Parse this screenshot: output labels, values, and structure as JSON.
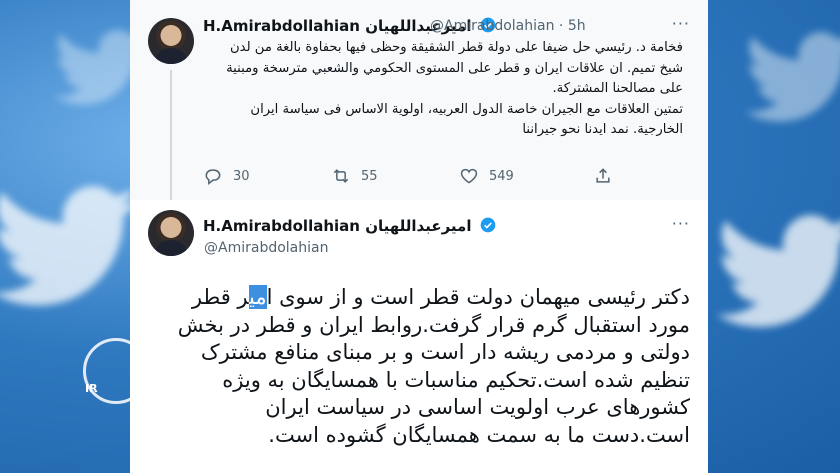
{
  "tweet1": {
    "name": "H.Amirabdollahian امیرعبداللهیان",
    "handle": "@Amirabdolahian · 5h",
    "more": "···",
    "text_p1": "فخامة د. رئيسي حل ضيفا على دولة قطر الشقيقة وحظى فيها بحفاوة بالغة من لدن شيخ تميم. ان علاقات ايران و قطر على المستوى الحكومي والشعبي مترسخة ومبنية على مصالحنا المشتركة.",
    "text_p2": "تمتين العلاقات مع الجيران خاصة الدول العربيه، اولوية الاساس فى سياسة ايران الخارجية. نمد ايدنا نحو جيراننا",
    "replies": "30",
    "retweets": "55",
    "likes": "549"
  },
  "tweet2": {
    "name": "H.Amirabdollahian امیرعبداللهیان",
    "handle": "@Amirabdolahian",
    "more": "···",
    "text_before": "دکتر رئیسی میهمان دولت قطر است و از سوی ا",
    "text_selected": "می",
    "text_after": "ر قطر مورد استقبال گرم قرار گرفت.روابط ایران و قطر در بخش دولتی و مردمی ریشه دار است و بر مبنای منافع مشترک تنظیم شده است.تحکیم مناسبات با همسایگان به ویژه کشورهای عرب اولویت اساسی در سیاست ایران است.دست ما به سمت همسایگان گشوده است."
  },
  "watermark": {
    "text": "IR"
  },
  "colors": {
    "verified": "#1d9bf0",
    "selection": "#3d8fe0",
    "background": "#3e86c9"
  }
}
